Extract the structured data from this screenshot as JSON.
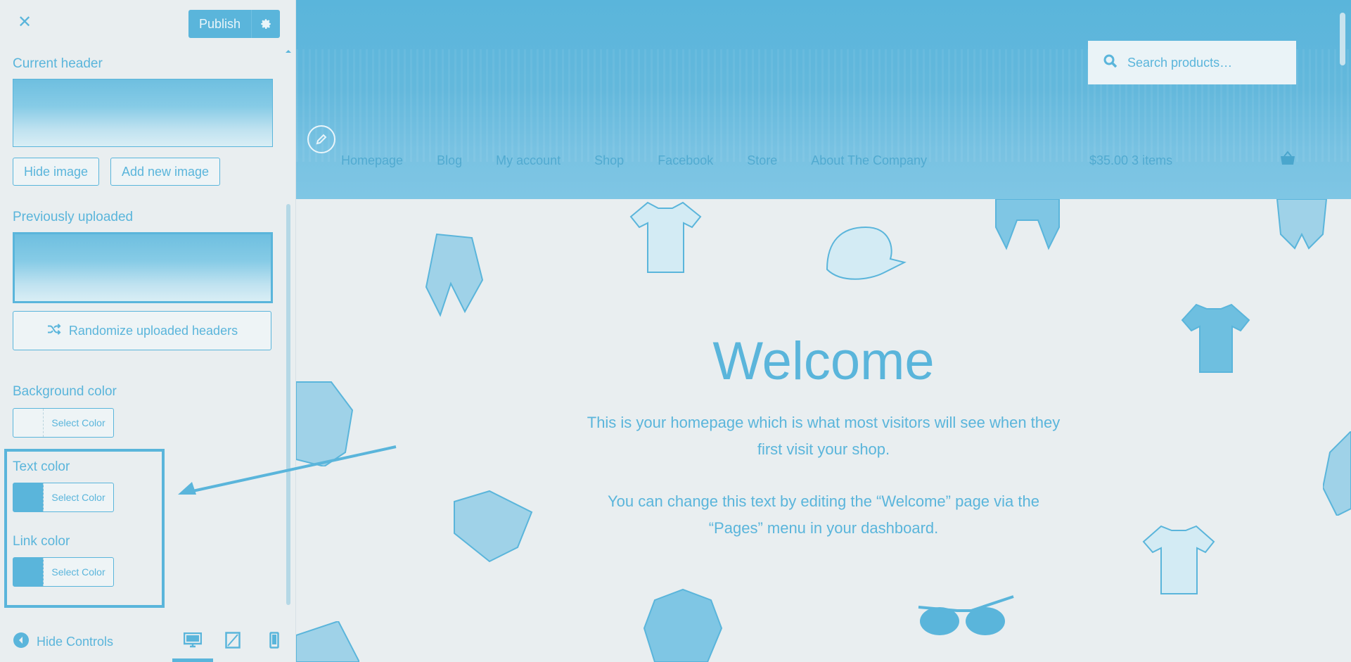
{
  "sidebar": {
    "close_icon": "close-icon",
    "publish_label": "Publish",
    "current_header_title": "Current header",
    "hide_image_label": "Hide image",
    "add_new_image_label": "Add new image",
    "previously_uploaded_title": "Previously uploaded",
    "randomize_label": "Randomize uploaded headers",
    "background_color_title": "Background color",
    "text_color_title": "Text color",
    "link_color_title": "Link color",
    "select_color_label": "Select Color",
    "hide_controls_label": "Hide Controls"
  },
  "preview": {
    "search_placeholder": "Search products…",
    "nav": [
      "Homepage",
      "Blog",
      "My account",
      "Shop",
      "Facebook",
      "Store",
      "About The Company"
    ],
    "cart_text": "$35.00  3 items",
    "welcome_title": "Welcome",
    "para1_line1": "This is your homepage which is what most visitors will see when they",
    "para1_line2": "first visit your shop.",
    "para2_line1": "You can change this text by editing the “Welcome” page via the",
    "para2_line2": "“Pages” menu in your dashboard."
  },
  "colors": {
    "accent": "#5ab5db",
    "background": "#e9eef0"
  }
}
